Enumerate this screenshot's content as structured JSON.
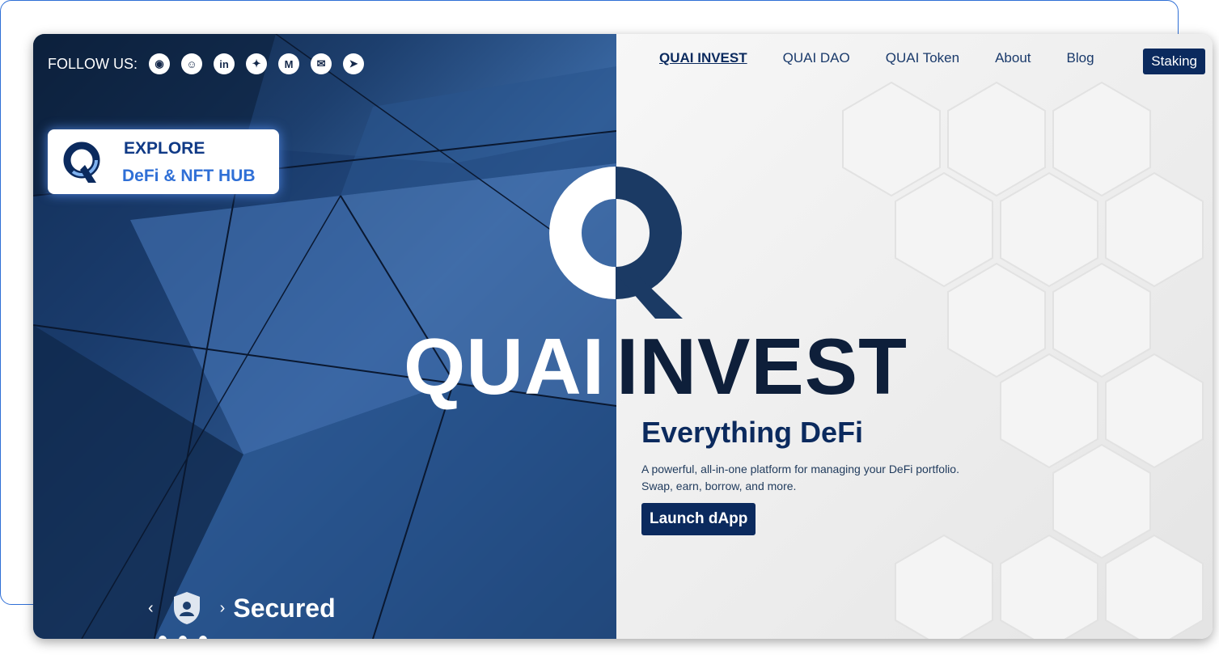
{
  "follow": {
    "label": "FOLLOW US:"
  },
  "social_icons": [
    "github-icon",
    "discord-icon",
    "linkedin-icon",
    "twitter-icon",
    "medium-icon",
    "mail-icon",
    "telegram-icon"
  ],
  "explore": {
    "line1": "EXPLORE",
    "line2": "DeFi & NFT HUB"
  },
  "nav": {
    "items": [
      "QUAI INVEST",
      "QUAI DAO",
      "QUAI Token",
      "About",
      "Blog"
    ],
    "active": "QUAI INVEST",
    "cta": "Staking"
  },
  "brand": {
    "left": "QUAI",
    "right": "INVEST"
  },
  "hero": {
    "headline": "Everything DeFi",
    "desc_line1": "A powerful, all-in-one platform for managing your DeFi portfolio.",
    "desc_line2": "Swap, earn, borrow, and more.",
    "cta": "Launch dApp"
  },
  "slider": {
    "label": "Secured"
  },
  "colors": {
    "primary": "#0b2a5e",
    "accent": "#2f6fd6",
    "text": "#1a3a6b"
  }
}
